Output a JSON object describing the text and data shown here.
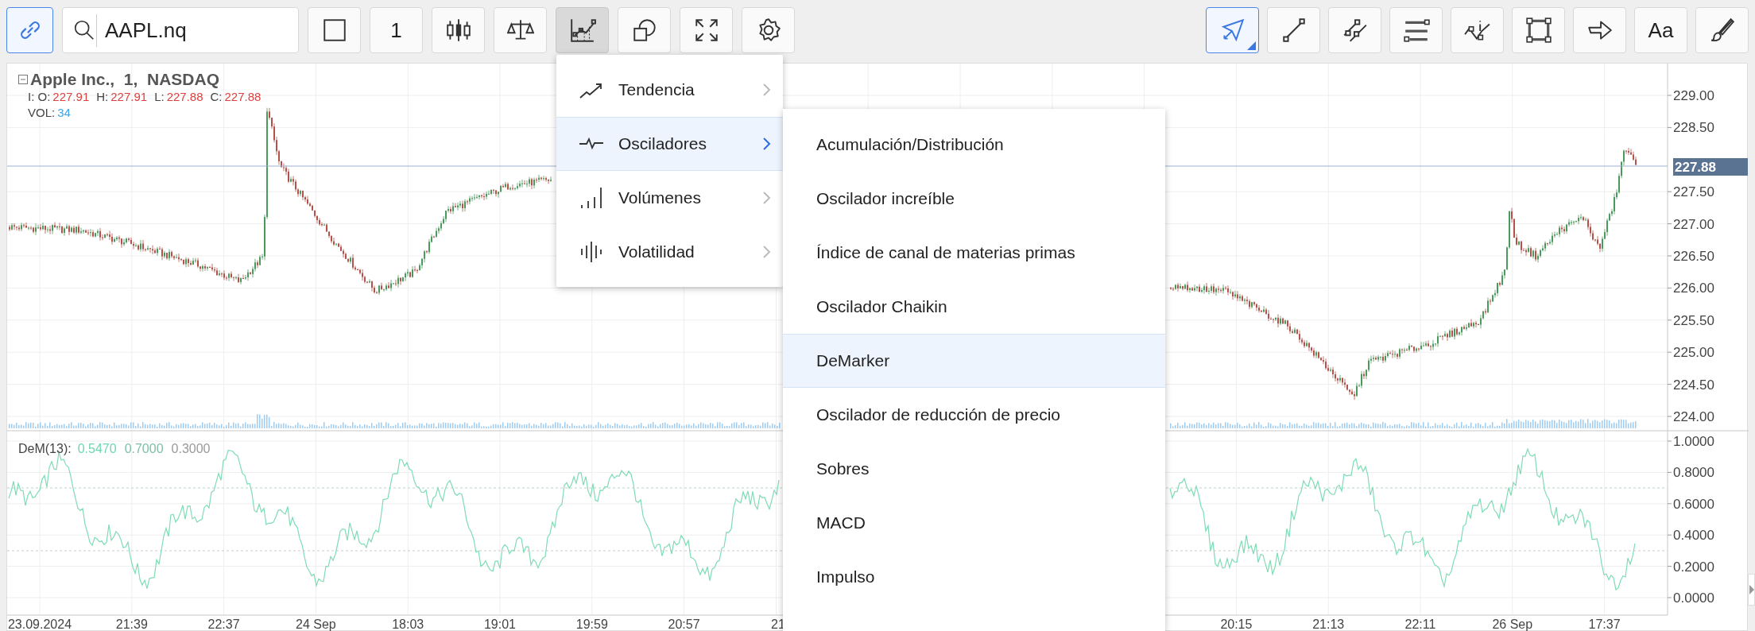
{
  "toolbar_left": [
    {
      "kind": "link",
      "selected": true
    },
    {
      "kind": "search",
      "value": "AAPL.nq"
    },
    {
      "kind": "square",
      "selected": false
    },
    {
      "kind": "text",
      "label": "1",
      "selected": false
    },
    {
      "kind": "candles",
      "selected": false
    },
    {
      "kind": "scales",
      "selected": false
    },
    {
      "kind": "indicators",
      "selected": true
    },
    {
      "kind": "shapes",
      "selected": false
    },
    {
      "kind": "fullscreen",
      "selected": false
    },
    {
      "kind": "settings",
      "selected": false
    }
  ],
  "toolbar_right": [
    {
      "kind": "pointer",
      "selected": true
    },
    {
      "kind": "line",
      "selected": false
    },
    {
      "kind": "parallel",
      "selected": false
    },
    {
      "kind": "hlines",
      "selected": false
    },
    {
      "kind": "infoline",
      "selected": false
    },
    {
      "kind": "rectangle",
      "selected": false
    },
    {
      "kind": "arrow",
      "selected": false
    },
    {
      "kind": "text",
      "label": "Aa",
      "selected": false
    },
    {
      "kind": "brush",
      "selected": false
    }
  ],
  "chart": {
    "title": "Apple Inc.,  1,  NASDAQ",
    "ohlc": [
      {
        "label": "I: O:",
        "value": "227.91"
      },
      {
        "label": "H:",
        "value": "227.91"
      },
      {
        "label": "L:",
        "value": "227.88"
      },
      {
        "label": "C:",
        "value": "227.88"
      }
    ],
    "volume": {
      "label": "VOL:",
      "value": "34"
    },
    "price_axis": [
      "229.00",
      "228.50",
      "227.50",
      "227.00",
      "226.50",
      "226.00",
      "225.50",
      "225.00",
      "224.50",
      "224.00"
    ],
    "current_price": "227.88",
    "oscillator": {
      "name": "DeM(13):",
      "values": [
        {
          "text": "0.5470",
          "color": "#6fd6ae"
        },
        {
          "text": "0.7000",
          "color": "#7fbfa6"
        },
        {
          "text": "0.3000",
          "color": "#999999"
        }
      ],
      "axis": [
        "1.0000",
        "0.8000",
        "0.6000",
        "0.4000",
        "0.2000",
        "0.0000"
      ]
    },
    "time_axis": [
      "23.09.2024",
      "21:39",
      "22:37",
      "24 Sep",
      "18:03",
      "19:01",
      "19:59",
      "20:57",
      "21",
      "20:15",
      "21:13",
      "22:11",
      "26 Sep",
      "17:37"
    ]
  },
  "menu": [
    {
      "kind": "trend",
      "label": "Tendencia",
      "selected": false
    },
    {
      "kind": "oscillator",
      "label": "Osciladores",
      "selected": true
    },
    {
      "kind": "volume",
      "label": "Volúmenes",
      "selected": false
    },
    {
      "kind": "volatility",
      "label": "Volatilidad",
      "selected": false
    }
  ],
  "submenu": [
    {
      "label": "Acumulación/Distribución",
      "selected": false
    },
    {
      "label": "Oscilador increíble",
      "selected": false
    },
    {
      "label": "Índice de canal de materias primas",
      "selected": false
    },
    {
      "label": "Oscilador Chaikin",
      "selected": false
    },
    {
      "label": "DeMarker",
      "selected": true
    },
    {
      "label": "Oscilador de reducción de precio",
      "selected": false
    },
    {
      "label": "Sobres",
      "selected": false
    },
    {
      "label": "MACD",
      "selected": false
    },
    {
      "label": "Impulso",
      "selected": false
    }
  ]
}
